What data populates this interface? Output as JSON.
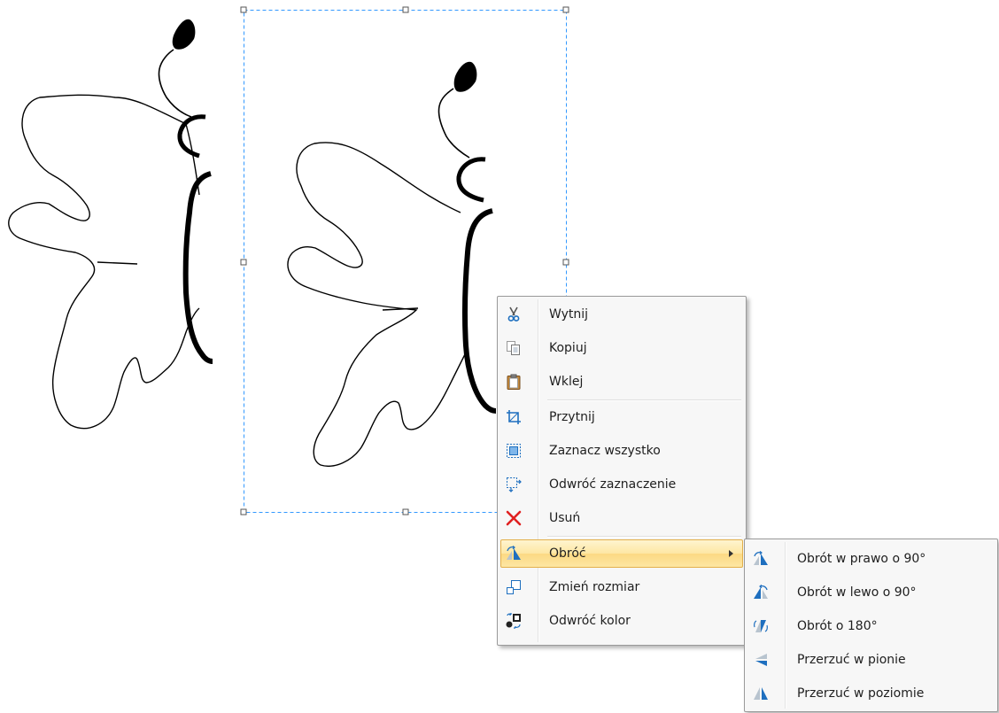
{
  "context_menu": {
    "items": [
      {
        "label": "Wytnij",
        "icon": "cut-icon"
      },
      {
        "label": "Kopiuj",
        "icon": "copy-icon"
      },
      {
        "label": "Wklej",
        "icon": "paste-icon"
      },
      {
        "label": "Przytnij",
        "icon": "crop-icon"
      },
      {
        "label": "Zaznacz wszystko",
        "icon": "select-all-icon"
      },
      {
        "label": "Odwróć zaznaczenie",
        "icon": "invert-selection-icon"
      },
      {
        "label": "Usuń",
        "icon": "delete-icon"
      },
      {
        "label": "Obróć",
        "icon": "rotate-icon",
        "has_submenu": true,
        "highlighted": true
      },
      {
        "label": "Zmień rozmiar",
        "icon": "resize-icon"
      },
      {
        "label": "Odwróć kolor",
        "icon": "invert-color-icon"
      }
    ]
  },
  "rotate_submenu": {
    "items": [
      {
        "label": "Obrót w prawo o 90°",
        "icon": "rotate-right-90-icon"
      },
      {
        "label": "Obrót w lewo o 90°",
        "icon": "rotate-left-90-icon"
      },
      {
        "label": "Obrót o 180°",
        "icon": "rotate-180-icon"
      },
      {
        "label": "Przerzuć w pionie",
        "icon": "flip-vertical-icon"
      },
      {
        "label": "Przerzuć w poziomie",
        "icon": "flip-horizontal-icon"
      }
    ]
  },
  "colors": {
    "selection_border": "#3399ff",
    "menu_highlight": "#fde7a3",
    "icon_blue": "#1e6fbf",
    "delete_red": "#e02020"
  }
}
